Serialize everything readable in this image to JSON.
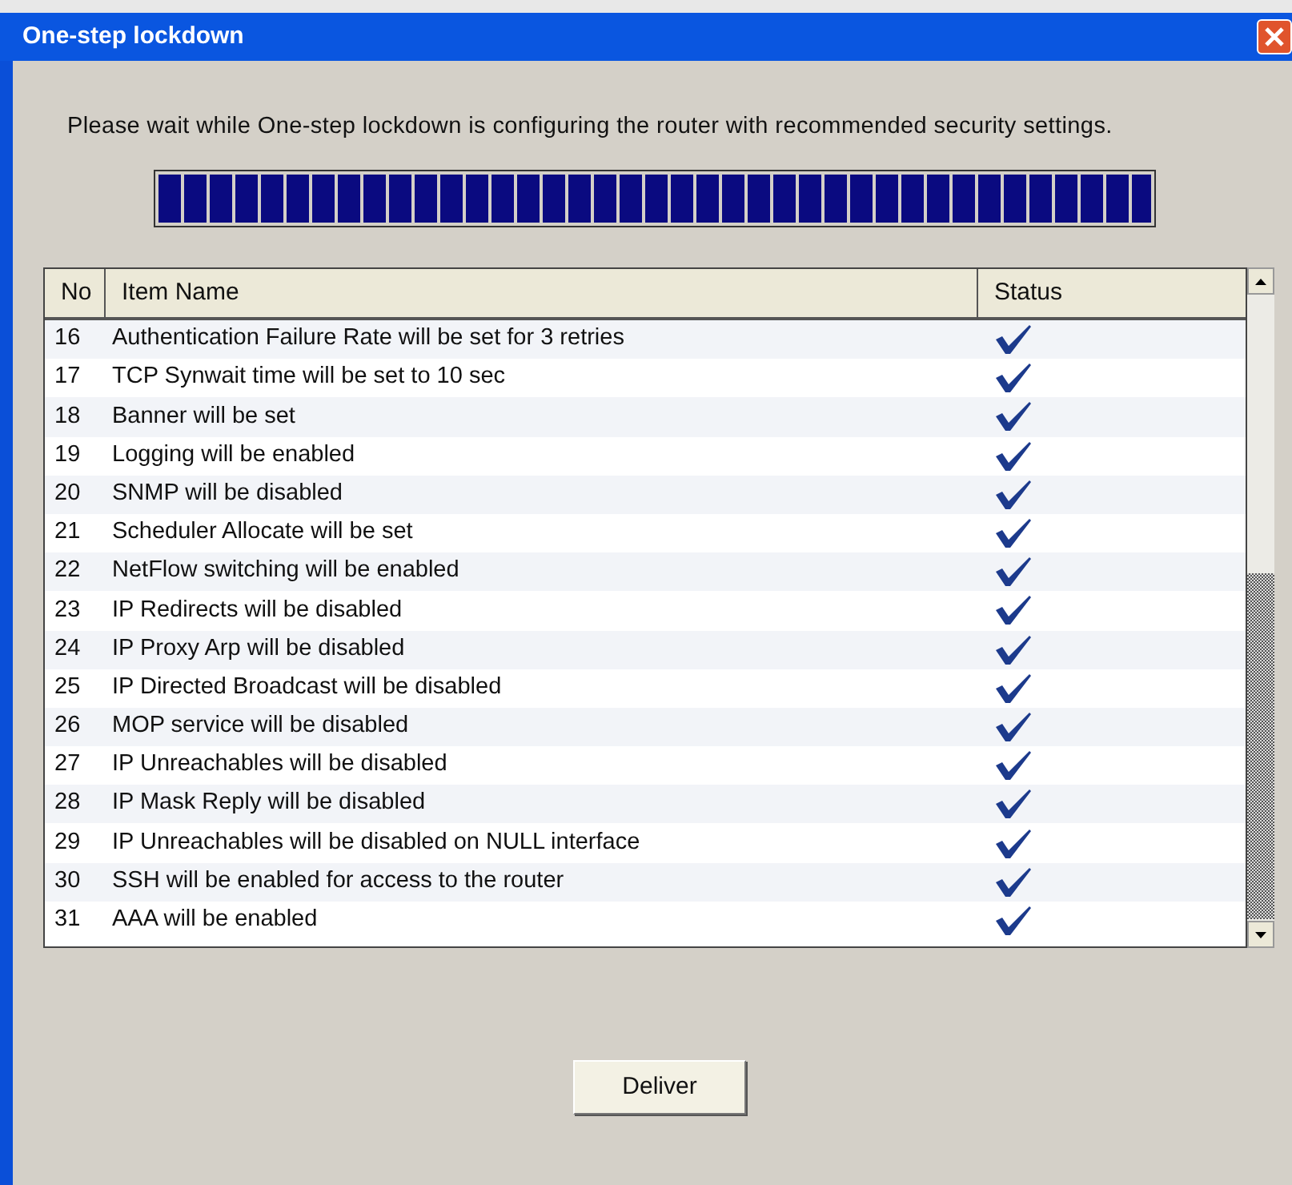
{
  "window": {
    "title": "One-step lockdown"
  },
  "message": "Please wait while One-step lockdown is configuring the router with recommended security settings.",
  "progress": {
    "level": 1
  },
  "table": {
    "columns": [
      "No",
      "Item Name",
      "Status"
    ],
    "rows": [
      {
        "no": "16",
        "name": "Authentication Failure Rate will be set for 3 retries",
        "done": true
      },
      {
        "no": "17",
        "name": "TCP Synwait time will be set to 10 sec",
        "done": true
      },
      {
        "no": "18",
        "name": "Banner will be set",
        "done": true
      },
      {
        "no": "19",
        "name": "Logging will be enabled",
        "done": true
      },
      {
        "no": "20",
        "name": "SNMP will be disabled",
        "done": true
      },
      {
        "no": "21",
        "name": "Scheduler Allocate will be set",
        "done": true
      },
      {
        "no": "22",
        "name": "NetFlow switching will be enabled",
        "done": true
      },
      {
        "no": "23",
        "name": "IP Redirects will be disabled",
        "done": true
      },
      {
        "no": "24",
        "name": "IP Proxy Arp will be disabled",
        "done": true
      },
      {
        "no": "25",
        "name": "IP Directed Broadcast will be disabled",
        "done": true
      },
      {
        "no": "26",
        "name": "MOP service will be disabled",
        "done": true
      },
      {
        "no": "27",
        "name": "IP Unreachables will be disabled",
        "done": true
      },
      {
        "no": "28",
        "name": "IP Mask Reply will be disabled",
        "done": true
      },
      {
        "no": "29",
        "name": "IP Unreachables will be disabled on NULL interface",
        "done": true
      },
      {
        "no": "30",
        "name": "SSH will be enabled for access to the router",
        "done": true
      },
      {
        "no": "31",
        "name": "AAA will be enabled",
        "done": true
      }
    ]
  },
  "buttons": [
    "Deliver"
  ]
}
